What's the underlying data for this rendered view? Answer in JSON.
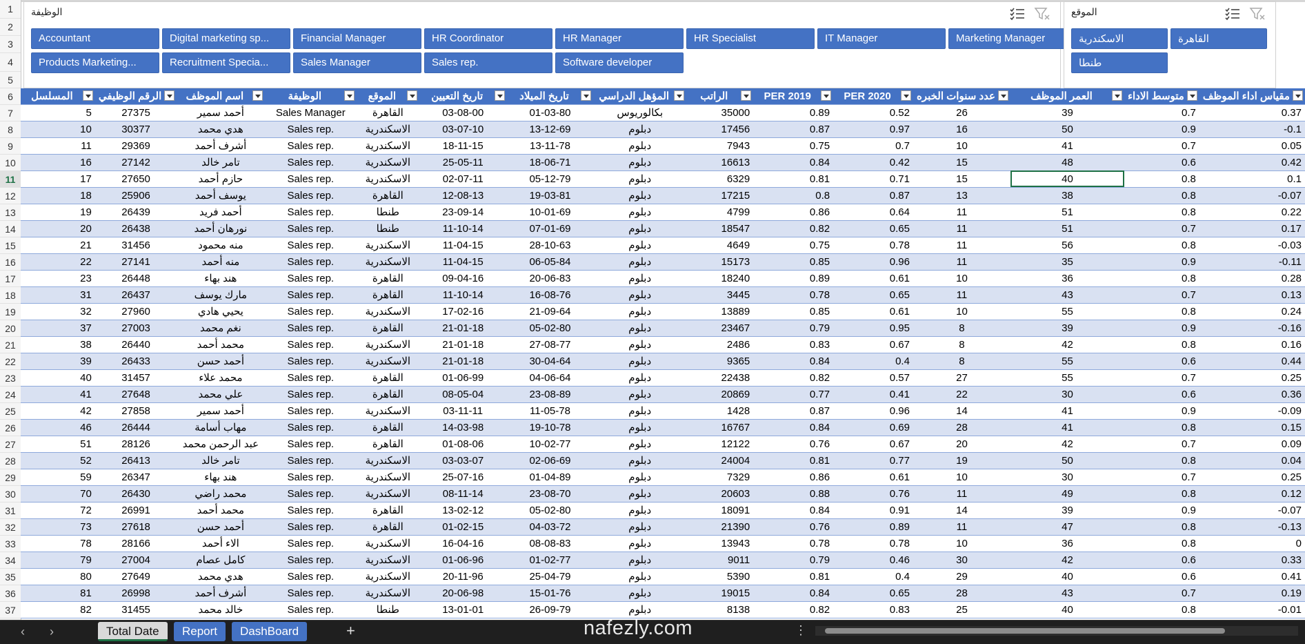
{
  "row_numbers": [
    "1",
    "2",
    "3",
    "4",
    "5",
    "6",
    "7",
    "8",
    "9",
    "10",
    "11",
    "12",
    "13",
    "14",
    "15",
    "16",
    "17",
    "18",
    "19",
    "20",
    "21",
    "22",
    "23",
    "24",
    "25",
    "26",
    "27",
    "28",
    "29",
    "30",
    "31",
    "32",
    "33",
    "34",
    "35",
    "36",
    "37"
  ],
  "slicer_job": {
    "title": "الوظيفة",
    "items": [
      "Accountant",
      "Digital marketing sp...",
      "Financial Manager",
      "HR Coordinator",
      "HR Manager",
      "HR Specialist",
      "IT Manager",
      "Marketing Manager",
      "Products Marketing...",
      "Recruitment Specia...",
      "Sales Manager",
      "Sales rep.",
      "Software developer"
    ]
  },
  "slicer_location": {
    "title": "الموقع",
    "items": [
      "الاسكندرية",
      "القاهرة",
      "طنطا"
    ]
  },
  "table": {
    "headers": [
      "المسلسل",
      "الرقم الوظيفي",
      "اسم الموظف",
      "الوظيفة",
      "الموقع",
      "تاريخ التعيين",
      "تاريخ الميلاد",
      "المؤهل الدراسي",
      "الراتب",
      "PER 2019",
      "PER 2020",
      "عدد سنوات الخبره",
      "العمر الموظف",
      "متوسط الاداء",
      "مقياس اداء الموظف"
    ],
    "rows": [
      [
        "5",
        "27375",
        "أحمد سمير",
        "Sales Manager",
        "القاهرة",
        "03-08-00",
        "01-03-80",
        "بكالوريوس",
        "35000",
        "0.89",
        "0.52",
        "26",
        "39",
        "0.7",
        "0.37"
      ],
      [
        "10",
        "30377",
        "هدي محمد",
        "Sales rep.",
        "الاسكندرية",
        "03-07-10",
        "13-12-69",
        "دبلوم",
        "17456",
        "0.87",
        "0.97",
        "16",
        "50",
        "0.9",
        "-0.1"
      ],
      [
        "11",
        "29369",
        "أشرف أحمد",
        "Sales rep.",
        "الاسكندرية",
        "18-11-15",
        "13-11-78",
        "دبلوم",
        "7943",
        "0.75",
        "0.7",
        "10",
        "41",
        "0.7",
        "0.05"
      ],
      [
        "16",
        "27142",
        "تامر خالد",
        "Sales rep.",
        "الاسكندرية",
        "25-05-11",
        "18-06-71",
        "دبلوم",
        "16613",
        "0.84",
        "0.42",
        "15",
        "48",
        "0.6",
        "0.42"
      ],
      [
        "17",
        "27650",
        "حازم أحمد",
        "Sales rep.",
        "الاسكندرية",
        "02-07-11",
        "05-12-79",
        "دبلوم",
        "6329",
        "0.81",
        "0.71",
        "15",
        "40",
        "0.8",
        "0.1"
      ],
      [
        "18",
        "25906",
        "يوسف أحمد",
        "Sales rep.",
        "القاهرة",
        "12-08-13",
        "19-03-81",
        "دبلوم",
        "17215",
        "0.8",
        "0.87",
        "13",
        "38",
        "0.8",
        "-0.07"
      ],
      [
        "19",
        "26439",
        "أحمد فريد",
        "Sales rep.",
        "طنطا",
        "23-09-14",
        "10-01-69",
        "دبلوم",
        "4799",
        "0.86",
        "0.64",
        "11",
        "51",
        "0.8",
        "0.22"
      ],
      [
        "20",
        "26438",
        "نورهان أحمد",
        "Sales rep.",
        "طنطا",
        "11-10-14",
        "07-01-69",
        "دبلوم",
        "18547",
        "0.82",
        "0.65",
        "11",
        "51",
        "0.7",
        "0.17"
      ],
      [
        "21",
        "31456",
        "منه محمود",
        "Sales rep.",
        "الاسكندرية",
        "11-04-15",
        "28-10-63",
        "دبلوم",
        "4649",
        "0.75",
        "0.78",
        "11",
        "56",
        "0.8",
        "-0.03"
      ],
      [
        "22",
        "27141",
        "منه أحمد",
        "Sales rep.",
        "الاسكندرية",
        "11-04-15",
        "06-05-84",
        "دبلوم",
        "15173",
        "0.85",
        "0.96",
        "11",
        "35",
        "0.9",
        "-0.11"
      ],
      [
        "23",
        "26448",
        "هند بهاء",
        "Sales rep.",
        "القاهرة",
        "09-04-16",
        "20-06-83",
        "دبلوم",
        "18240",
        "0.89",
        "0.61",
        "10",
        "36",
        "0.8",
        "0.28"
      ],
      [
        "31",
        "26437",
        "مارك يوسف",
        "Sales rep.",
        "القاهرة",
        "11-10-14",
        "16-08-76",
        "دبلوم",
        "3445",
        "0.78",
        "0.65",
        "11",
        "43",
        "0.7",
        "0.13"
      ],
      [
        "32",
        "27960",
        "يحيي هادي",
        "Sales rep.",
        "الاسكندرية",
        "17-02-16",
        "21-09-64",
        "دبلوم",
        "13889",
        "0.85",
        "0.61",
        "10",
        "55",
        "0.8",
        "0.24"
      ],
      [
        "37",
        "27003",
        "نغم محمد",
        "Sales rep.",
        "القاهرة",
        "21-01-18",
        "05-02-80",
        "دبلوم",
        "23467",
        "0.79",
        "0.95",
        "8",
        "39",
        "0.9",
        "-0.16"
      ],
      [
        "38",
        "26440",
        "محمد أحمد",
        "Sales rep.",
        "الاسكندرية",
        "21-01-18",
        "27-08-77",
        "دبلوم",
        "2486",
        "0.83",
        "0.67",
        "8",
        "42",
        "0.8",
        "0.16"
      ],
      [
        "39",
        "26433",
        "أحمد حسن",
        "Sales rep.",
        "الاسكندرية",
        "21-01-18",
        "30-04-64",
        "دبلوم",
        "9365",
        "0.84",
        "0.4",
        "8",
        "55",
        "0.6",
        "0.44"
      ],
      [
        "40",
        "31457",
        "محمد علاء",
        "Sales rep.",
        "القاهرة",
        "01-06-99",
        "04-06-64",
        "دبلوم",
        "22438",
        "0.82",
        "0.57",
        "27",
        "55",
        "0.7",
        "0.25"
      ],
      [
        "41",
        "27648",
        "علي محمد",
        "Sales rep.",
        "القاهرة",
        "08-05-04",
        "23-08-89",
        "دبلوم",
        "20869",
        "0.77",
        "0.41",
        "22",
        "30",
        "0.6",
        "0.36"
      ],
      [
        "42",
        "27858",
        "أحمد سمير",
        "Sales rep.",
        "الاسكندرية",
        "03-11-11",
        "11-05-78",
        "دبلوم",
        "1428",
        "0.87",
        "0.96",
        "14",
        "41",
        "0.9",
        "-0.09"
      ],
      [
        "46",
        "26444",
        "مهاب أسامة",
        "Sales rep.",
        "القاهرة",
        "14-03-98",
        "19-10-78",
        "دبلوم",
        "16767",
        "0.84",
        "0.69",
        "28",
        "41",
        "0.8",
        "0.15"
      ],
      [
        "51",
        "28126",
        "عبد الرحمن محمد",
        "Sales rep.",
        "القاهرة",
        "01-08-06",
        "10-02-77",
        "دبلوم",
        "12122",
        "0.76",
        "0.67",
        "20",
        "42",
        "0.7",
        "0.09"
      ],
      [
        "52",
        "26413",
        "تامر خالد",
        "Sales rep.",
        "الاسكندرية",
        "03-03-07",
        "02-06-69",
        "دبلوم",
        "24004",
        "0.81",
        "0.77",
        "19",
        "50",
        "0.8",
        "0.04"
      ],
      [
        "59",
        "26347",
        "هند بهاء",
        "Sales rep.",
        "الاسكندرية",
        "25-07-16",
        "01-04-89",
        "دبلوم",
        "7329",
        "0.86",
        "0.61",
        "10",
        "30",
        "0.7",
        "0.25"
      ],
      [
        "70",
        "26430",
        "محمد راضي",
        "Sales rep.",
        "الاسكندرية",
        "08-11-14",
        "23-08-70",
        "دبلوم",
        "20603",
        "0.88",
        "0.76",
        "11",
        "49",
        "0.8",
        "0.12"
      ],
      [
        "72",
        "26991",
        "محمد أحمد",
        "Sales rep.",
        "القاهرة",
        "13-02-12",
        "05-02-80",
        "دبلوم",
        "18091",
        "0.84",
        "0.91",
        "14",
        "39",
        "0.9",
        "-0.07"
      ],
      [
        "73",
        "27618",
        "أحمد حسن",
        "Sales rep.",
        "القاهرة",
        "01-02-15",
        "04-03-72",
        "دبلوم",
        "21390",
        "0.76",
        "0.89",
        "11",
        "47",
        "0.8",
        "-0.13"
      ],
      [
        "78",
        "28166",
        "الاء أحمد",
        "Sales rep.",
        "الاسكندرية",
        "16-04-16",
        "08-08-83",
        "دبلوم",
        "13943",
        "0.78",
        "0.78",
        "10",
        "36",
        "0.8",
        "0"
      ],
      [
        "79",
        "27004",
        "كامل عصام",
        "Sales rep.",
        "الاسكندرية",
        "01-06-96",
        "01-02-77",
        "دبلوم",
        "9011",
        "0.79",
        "0.46",
        "30",
        "42",
        "0.6",
        "0.33"
      ],
      [
        "80",
        "27649",
        "هدي محمد",
        "Sales rep.",
        "الاسكندرية",
        "20-11-96",
        "25-04-79",
        "دبلوم",
        "5390",
        "0.81",
        "0.4",
        "29",
        "40",
        "0.6",
        "0.41"
      ],
      [
        "81",
        "26998",
        "أشرف أحمد",
        "Sales rep.",
        "الاسكندرية",
        "20-06-98",
        "15-01-76",
        "دبلوم",
        "19015",
        "0.84",
        "0.65",
        "28",
        "43",
        "0.7",
        "0.19"
      ],
      [
        "82",
        "31455",
        "خالد محمد",
        "Sales rep.",
        "طنطا",
        "13-01-01",
        "26-09-79",
        "دبلوم",
        "8138",
        "0.82",
        "0.83",
        "25",
        "40",
        "0.8",
        "-0.01"
      ]
    ]
  },
  "sheet_tabs": [
    "Total Date",
    "Report",
    "DashBoard"
  ],
  "active_tab": "Total Date",
  "watermark": "nafezly.com",
  "colors": {
    "accent": "#4472c4",
    "band": "#d9e1f2",
    "active_cell": "#1e7145"
  }
}
